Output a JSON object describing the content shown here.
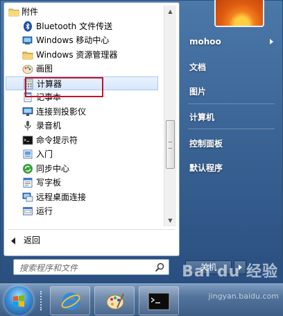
{
  "programs": {
    "folder_label": "附件",
    "items": [
      {
        "label": "Bluetooth 文件传送",
        "icon": "bluetooth-icon"
      },
      {
        "label": "Windows 移动中心",
        "icon": "mobility-center-icon"
      },
      {
        "label": "Windows 资源管理器",
        "icon": "explorer-folder-icon"
      },
      {
        "label": "画图",
        "icon": "paint-icon"
      },
      {
        "label": "计算器",
        "icon": "calculator-icon"
      },
      {
        "label": "记事本",
        "icon": "notepad-icon"
      },
      {
        "label": "连接到投影仪",
        "icon": "projector-icon"
      },
      {
        "label": "录音机",
        "icon": "microphone-icon"
      },
      {
        "label": "命令提示符",
        "icon": "command-prompt-icon"
      },
      {
        "label": "入门",
        "icon": "getting-started-icon"
      },
      {
        "label": "同步中心",
        "icon": "sync-center-icon"
      },
      {
        "label": "写字板",
        "icon": "wordpad-icon"
      },
      {
        "label": "远程桌面连接",
        "icon": "remote-desktop-icon"
      },
      {
        "label": "运行",
        "icon": "run-icon"
      }
    ],
    "highlighted_index": 4
  },
  "back_label": "返回",
  "search": {
    "placeholder": "搜索程序和文件"
  },
  "right_menu": {
    "user": "mohoo",
    "documents": "文档",
    "pictures": "图片",
    "computer": "计算机",
    "control_panel": "控制面板",
    "default_programs": "默认程序"
  },
  "shutdown_label": "关机",
  "watermark": {
    "brand": "Bai du 经验",
    "url": "jingyan.baidu.com"
  },
  "colors": {
    "highlight_border": "#c8102e",
    "menu_blue": "#2f5f94"
  }
}
